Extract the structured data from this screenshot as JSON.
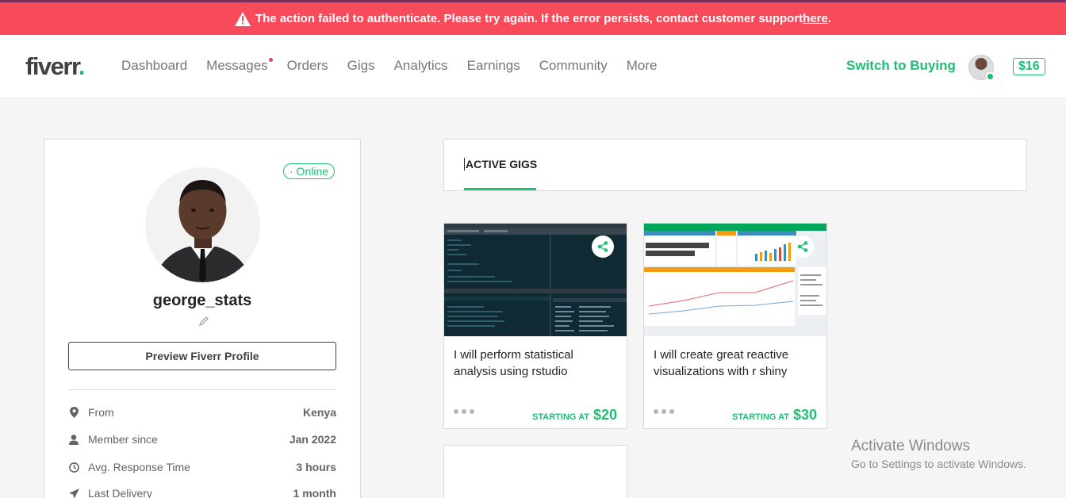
{
  "alert": {
    "message": "The action failed to authenticate. Please try again. If the error persists, contact customer support ",
    "link": "here",
    "period": "."
  },
  "header": {
    "logo": "fiverr",
    "logo_dot": ".",
    "nav": [
      "Dashboard",
      "Messages",
      "Orders",
      "Gigs",
      "Analytics",
      "Earnings",
      "Community",
      "More"
    ],
    "switch_label": "Switch to Buying",
    "balance": "$16"
  },
  "profile": {
    "status": "· Online",
    "username": "george_stats",
    "preview_button": "Preview Fiverr Profile",
    "stats": [
      {
        "label": "From",
        "value": "Kenya",
        "icon": "location-pin-icon"
      },
      {
        "label": "Member since",
        "value": "Jan 2022",
        "icon": "user-icon"
      },
      {
        "label": "Avg. Response Time",
        "value": "3 hours",
        "icon": "clock-icon"
      },
      {
        "label": "Last Delivery",
        "value": "1 month",
        "icon": "paper-plane-icon"
      }
    ]
  },
  "tabs": {
    "active": "ACTIVE GIGS"
  },
  "gigs": [
    {
      "title": "I will perform statistical analysis using rstudio",
      "starting_label": "STARTING AT",
      "price": "$20"
    },
    {
      "title": "I will create great reactive visualizations with r shiny",
      "starting_label": "STARTING AT",
      "price": "$30"
    }
  ],
  "watermark": {
    "line1": "Activate Windows",
    "line2": "Go to Settings to activate Windows."
  },
  "colors": {
    "brand_green": "#1dbf73",
    "alert_red": "#f74b5c",
    "notification_pink": "#e5407b"
  }
}
